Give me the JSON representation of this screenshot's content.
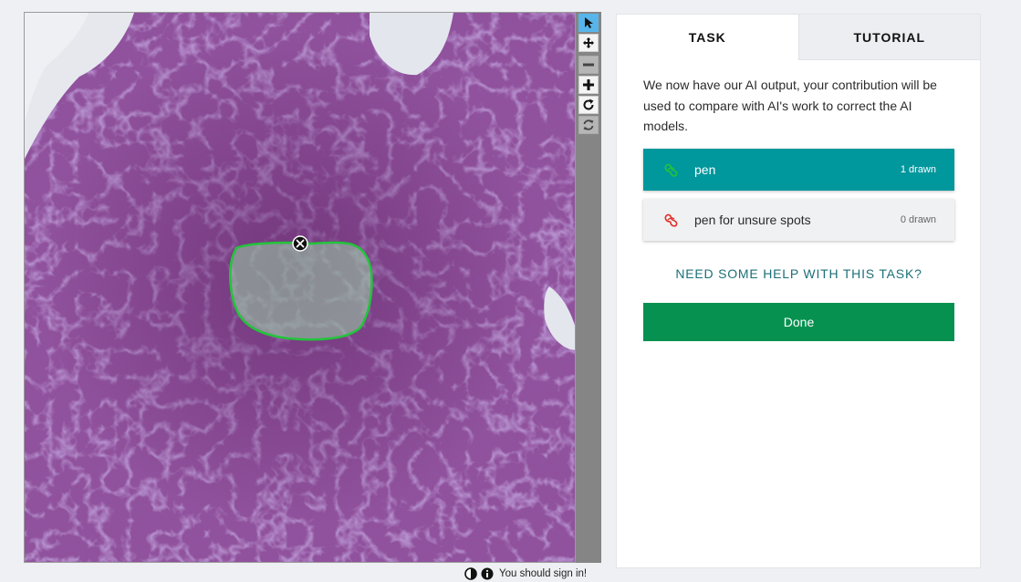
{
  "tabs": [
    {
      "label": "TASK",
      "active": true
    },
    {
      "label": "TUTORIAL",
      "active": false
    }
  ],
  "task": {
    "instructions": "We now have our AI output, your contribution will be used to compare with AI's work to correct the AI models.",
    "tools": [
      {
        "label": "pen",
        "count": "1 drawn",
        "color": "#22c43a",
        "selected": true
      },
      {
        "label": "pen for unsure spots",
        "count": "0 drawn",
        "color": "#e0302a",
        "selected": false
      }
    ],
    "help_link": "NEED SOME HELP WITH THIS TASK?",
    "done_label": "Done"
  },
  "viewer": {
    "toolbar": [
      {
        "name": "select-tool",
        "icon": "arrow-pointer-icon",
        "active": true
      },
      {
        "name": "pan-tool",
        "icon": "move-arrows-icon"
      },
      {
        "name": "zoom-out-tool",
        "icon": "minus-icon",
        "disabled": true
      },
      {
        "name": "zoom-in-tool",
        "icon": "plus-icon"
      },
      {
        "name": "rotate-tool",
        "icon": "rotate-icon"
      },
      {
        "name": "reset-tool",
        "icon": "refresh-icon",
        "disabled": true
      }
    ],
    "annotation_color": "#22c43a"
  },
  "status": {
    "message": "You should sign in!",
    "icons": [
      "contrast-icon",
      "info-icon"
    ]
  },
  "colors": {
    "teal": "#00979d",
    "green_button": "#079150",
    "tissue_base": "#8a4d9a"
  }
}
